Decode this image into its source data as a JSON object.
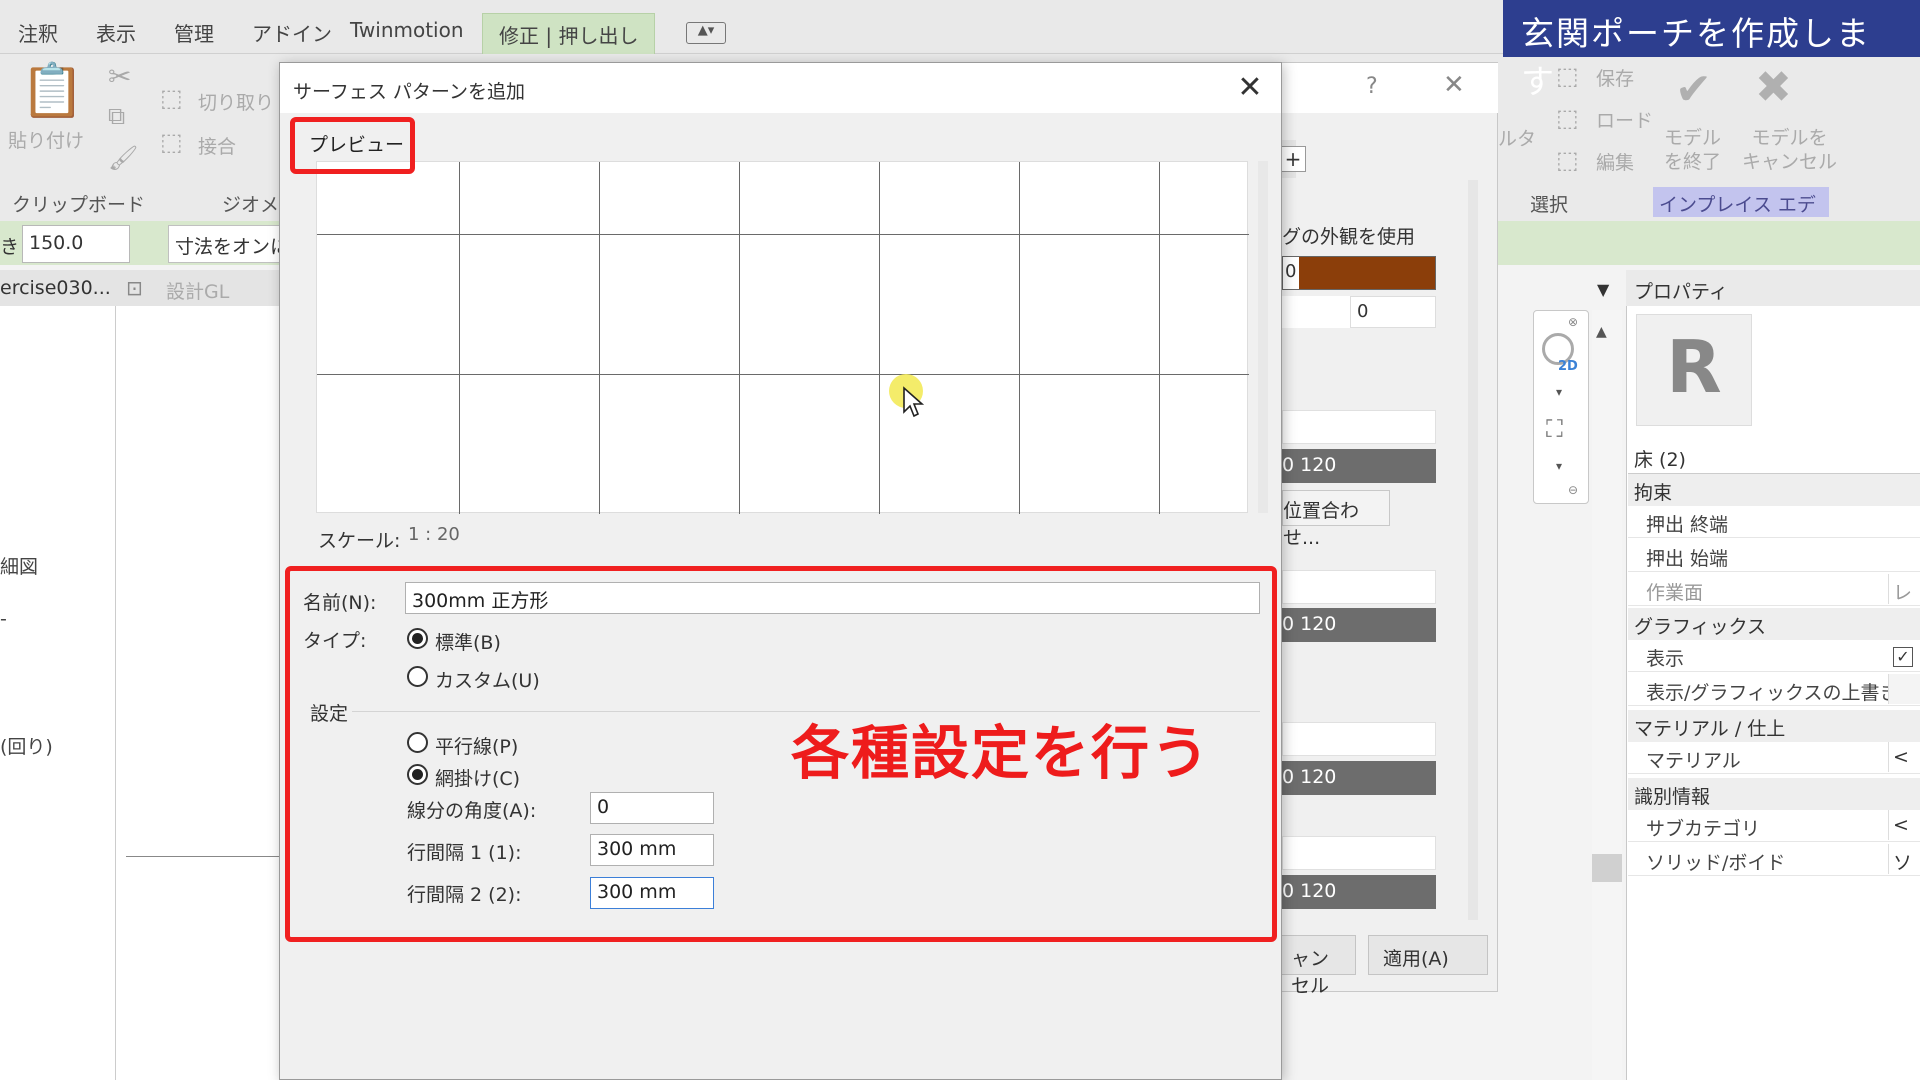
{
  "menubar": {
    "items": [
      "注釈",
      "表示",
      "管理",
      "アドイン",
      "Twinmotion"
    ],
    "active_tab": "修正 | 押し出し"
  },
  "ribbon": {
    "paste": "貼り付け",
    "cut": "切り取り",
    "join": "接合",
    "clipboard_group": "クリップボード",
    "geometry_group": "ジオメト",
    "save": "保存",
    "load": "ロード",
    "edit": "編集",
    "finish_model": "モデル\nを終了",
    "cancel_model": "モデルを\nキャンセル",
    "select_group": "選択",
    "inplace_editor": "インプレイス エディタ",
    "filter_text": "ルタ"
  },
  "options_bar": {
    "offset_prefix": "き",
    "offset_value": "150.0",
    "dimension_toggle": "寸法をオンに"
  },
  "title_banner": "玄関ポーチを作成します",
  "view_tabs": {
    "tab1": "ercise030...",
    "tab2": "設計GL"
  },
  "left_panel": {
    "item1": "細図",
    "item2": "(回り)"
  },
  "bg_dialog": {
    "help": "?",
    "close": "✕",
    "plus": "+",
    "use_appearance": "グの外観を使用",
    "color_value": "0",
    "field_value": "0",
    "bar_values": [
      "0 120",
      "0 120",
      "0 120",
      "0 120"
    ],
    "align_button": "位置合わせ...",
    "cancel_button": "ャンセル",
    "apply_button": "適用(A)"
  },
  "properties": {
    "header": "プロパティ",
    "type_selector": "床 (2)",
    "sections": [
      "拘束",
      "グラフィックス",
      "マテリアル / 仕上",
      "識別情報"
    ],
    "rows": {
      "extrusion_end": "押出 終端",
      "extrusion_start": "押出 始端",
      "work_plane": "作業面",
      "work_plane_value": "レベ",
      "visible": "表示",
      "visibility_override": "表示/グラフィックスの上書き",
      "material": "マテリアル",
      "material_value": "<カ",
      "subcategory": "サブカテゴリ",
      "subcategory_value": "<な",
      "solid_void": "ソリッド/ボイド",
      "solid_void_value": "ソリ"
    },
    "logo_letter": "R"
  },
  "dialog": {
    "title": "サーフェス パターンを追加",
    "preview_label": "プレビュー",
    "scale_label": "スケール:",
    "scale_value": "1 : 20",
    "name_label": "名前(N):",
    "name_value": "300mm 正方形",
    "type_label": "タイプ:",
    "type_standard": "標準(B)",
    "type_custom": "カスタム(U)",
    "type_selected": "standard",
    "settings_label": "設定",
    "parallel": "平行線(P)",
    "crosshatch": "網掛け(C)",
    "pattern_selected": "crosshatch",
    "angle_label": "線分の角度(A):",
    "angle_value": "0",
    "spacing1_label": "行間隔 1 (1):",
    "spacing1_value": "300 mm",
    "spacing2_label": "行間隔 2 (2):",
    "spacing2_value": "300 mm"
  },
  "annotation": "各種設定を行う",
  "colors": {
    "accent_red": "#f02020",
    "banner_blue": "#2d3e8f",
    "ribbon_green": "#d8e8cd",
    "material_brown": "#8b3e0a"
  }
}
